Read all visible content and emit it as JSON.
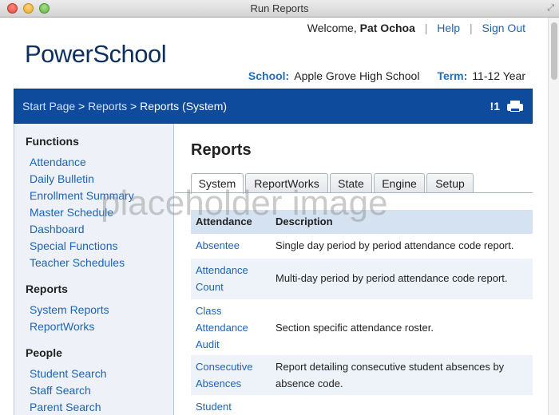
{
  "window": {
    "title": "Run Reports"
  },
  "header": {
    "welcome": "Welcome,",
    "user_name": "Pat Ochoa",
    "help_label": "Help",
    "signout_label": "Sign Out",
    "logo_text": "PowerSchool",
    "school_label": "School:",
    "school_name": "Apple Grove High School",
    "term_label": "Term:",
    "term_value": "11-12 Year"
  },
  "breadcrumb": {
    "start_page": "Start Page",
    "reports": "Reports",
    "current": "Reports (System)",
    "sep": ">",
    "alert": "!1"
  },
  "sidebar": {
    "functions_heading": "Functions",
    "functions": [
      "Attendance",
      "Daily Bulletin",
      "Enrollment Summary",
      "Master Schedule",
      "Dashboard",
      "Special Functions",
      "Teacher Schedules"
    ],
    "reports_heading": "Reports",
    "reports": [
      "System Reports",
      "ReportWorks"
    ],
    "people_heading": "People",
    "people": [
      "Student Search",
      "Staff Search",
      "Parent Search"
    ]
  },
  "main": {
    "title": "Reports",
    "tabs": [
      "System",
      "ReportWorks",
      "State",
      "Engine",
      "Setup"
    ],
    "active_tab": "System",
    "table": {
      "col_name": "Attendance",
      "col_desc": "Description",
      "rows": [
        {
          "name": "Absentee",
          "desc": "Single day period by period attendance code report."
        },
        {
          "name": "Attendance Count",
          "desc": "Multi-day period by period attendance code report."
        },
        {
          "name": "Class Attendance Audit",
          "desc": "Section specific attendance roster."
        },
        {
          "name": "Consecutive Absences",
          "desc": "Report detailing consecutive student absences by absence code."
        },
        {
          "name": "Student",
          "desc": ""
        }
      ]
    }
  },
  "overlay": {
    "placeholder": "placeholder image"
  }
}
